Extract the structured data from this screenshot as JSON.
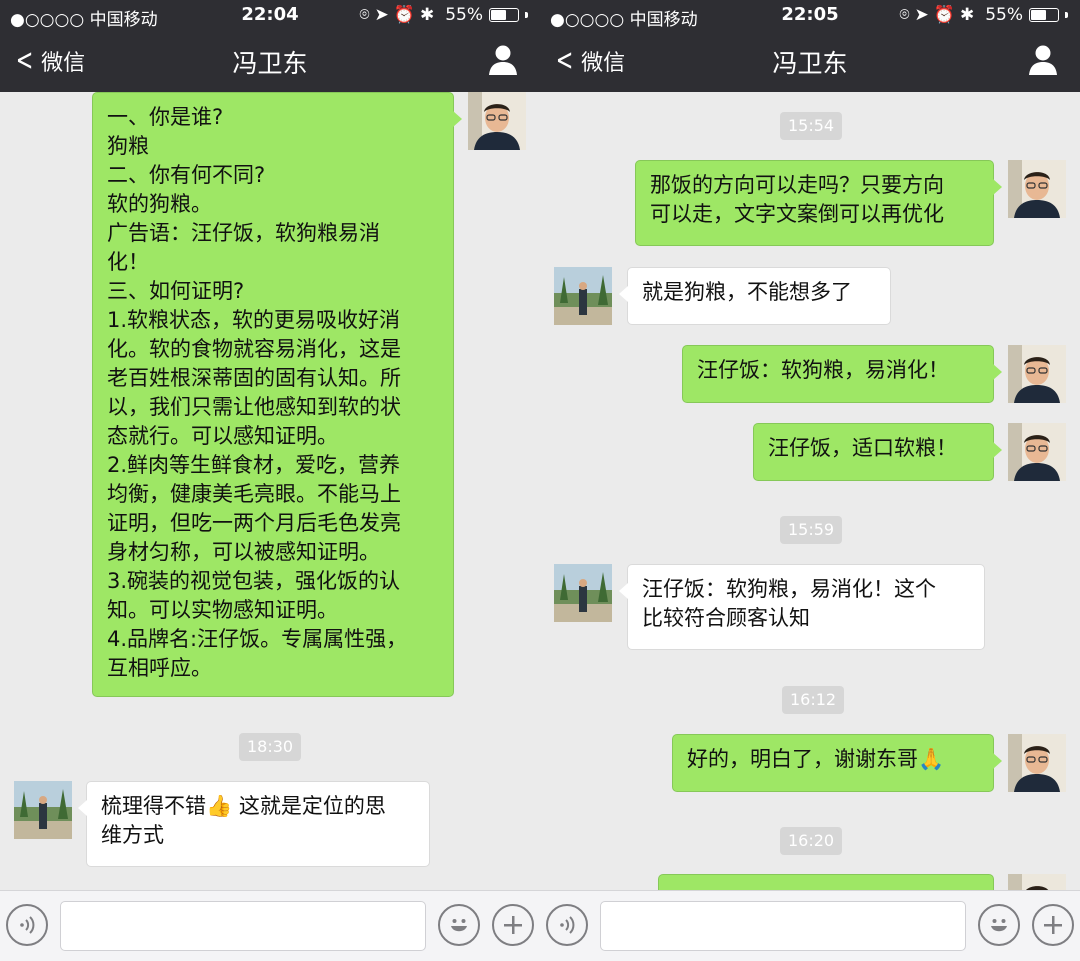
{
  "left": {
    "status": {
      "carrier": "●○○○○ 中国移动",
      "time": "22:04",
      "battery": "55%"
    },
    "nav": {
      "back": "微信",
      "title": "冯卫东"
    },
    "messages": [
      {
        "text": "一、你是谁?\n狗粮\n二、你有何不同?\n软的狗粮。\n广告语：汪仔饭，软狗粮易消\n化！\n三、如何证明?\n1.软粮状态，软的更易吸收好消\n化。软的食物就容易消化，这是\n老百姓根深蒂固的固有认知。所\n以，我们只需让他感知到软的状\n态就行。可以感知证明。\n2.鲜肉等生鲜食材，爱吃，营养\n均衡，健康美毛亮眼。不能马上\n证明，但吃一两个月后毛色发亮\n身材匀称，可以被感知证明。\n3.碗装的视觉包装，强化饭的认\n知。可以实物感知证明。\n4.品牌名:汪仔饭。专属属性强，\n互相呼应。"
      },
      {
        "time": "18:30"
      },
      {
        "text": "梳理得不错👍 这就是定位的思\n维方式"
      }
    ]
  },
  "right": {
    "status": {
      "carrier": "●○○○○ 中国移动",
      "time": "22:05",
      "battery": "55%"
    },
    "nav": {
      "back": "微信",
      "title": "冯卫东"
    },
    "messages": [
      {
        "time": "15:54"
      },
      {
        "text": "那饭的方向可以走吗？只要方向\n可以走，文字文案倒可以再优化"
      },
      {
        "text": "就是狗粮，不能想多了"
      },
      {
        "text": "汪仔饭：软狗粮，易消化！"
      },
      {
        "text": "汪仔饭，适口软粮！"
      },
      {
        "time": "15:59"
      },
      {
        "text": "汪仔饭：软狗粮，易消化！这个\n比较符合顾客认知"
      },
      {
        "time": "16:12"
      },
      {
        "text": "好的，明白了，谢谢东哥🙏"
      },
      {
        "time": "16:20"
      }
    ]
  },
  "battery_level": 0.55,
  "colors": {
    "nav_bg": "#2e2e33",
    "chat_bg": "#ebebeb",
    "sent_bubble": "#9ee765",
    "received_bubble": "#ffffff"
  },
  "icons": [
    "back-chevron-icon",
    "person-icon",
    "voice-icon",
    "emoji-icon",
    "plus-icon",
    "wifi-icon",
    "location-icon",
    "alarm-icon",
    "bluetooth-icon",
    "battery-icon"
  ]
}
